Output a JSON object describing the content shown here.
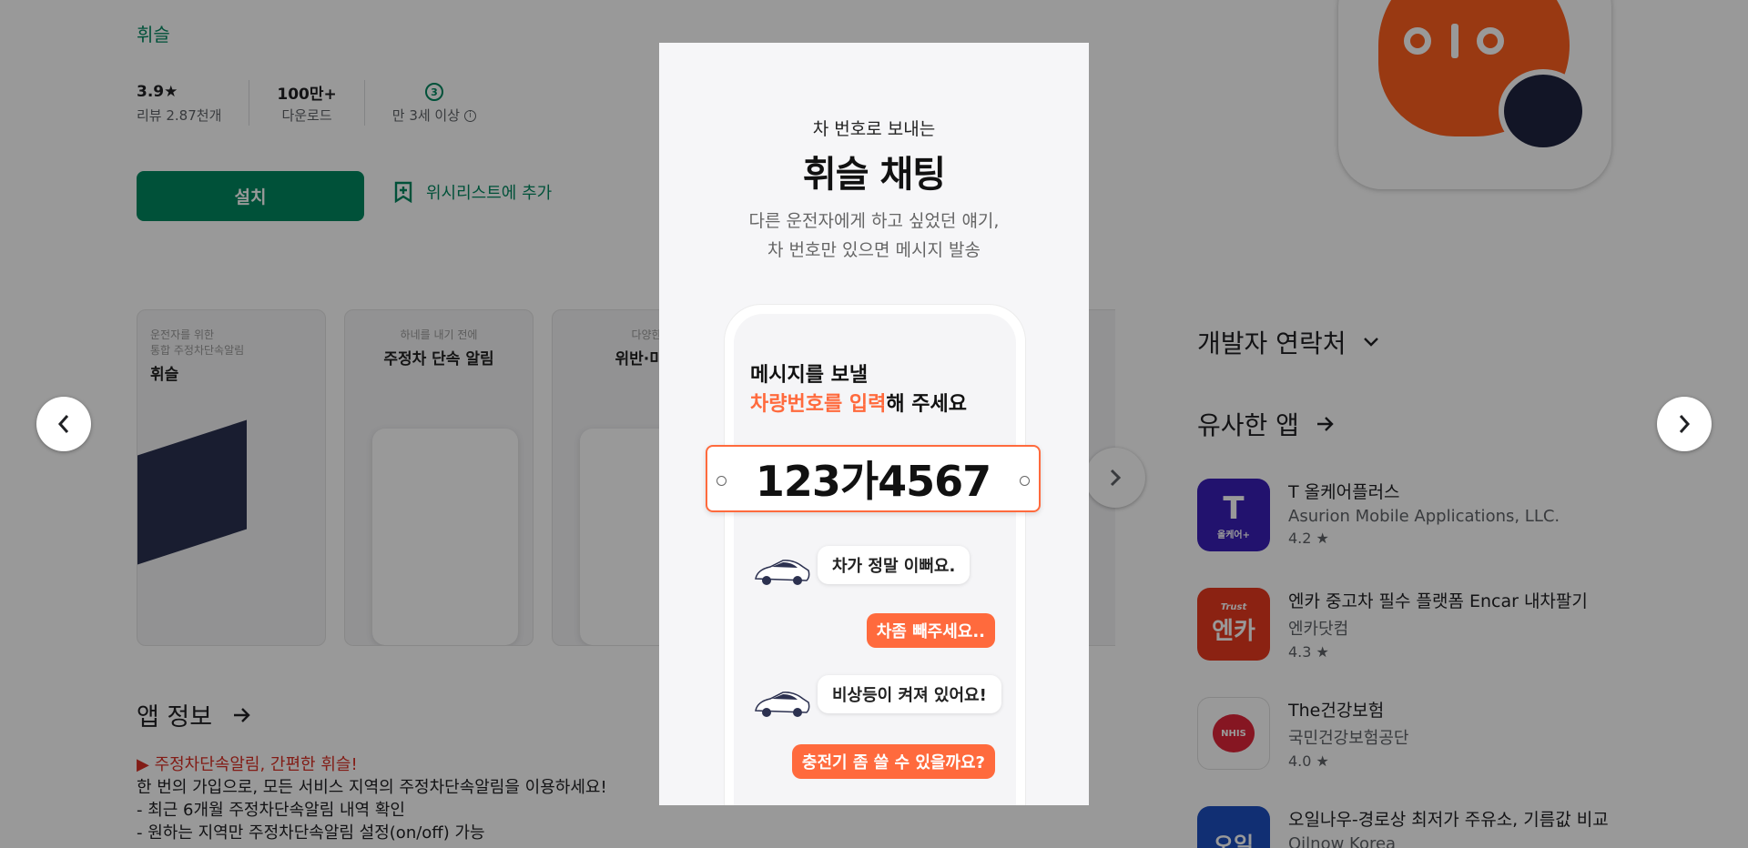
{
  "header": {
    "developer": "휘슬"
  },
  "stats": [
    {
      "value": "3.9★",
      "label": "리뷰 2.87천개"
    },
    {
      "value": "100만+",
      "label": "다운로드"
    },
    {
      "value": "3",
      "label": "만 3세 이상"
    }
  ],
  "actions": {
    "install": "설치",
    "wishlist": "위시리스트에 추가"
  },
  "screenshots": [
    {
      "small": "운전자를 위한\n통합 주정차단속알림",
      "big": "휘슬"
    },
    {
      "small": "하네를 내기 전에",
      "big": "주정차 단속 알림"
    },
    {
      "small": "다양한",
      "big": "위반·미납"
    }
  ],
  "about": {
    "title": "앱 정보",
    "lines": [
      "▶ 주정차단속알림, 간편한 휘슬!",
      "한 번의 가입으로, 모든 서비스 지역의 주정차단속알림을 이용하세요!",
      "- 최근 6개월 주정차단속알림 내역 확인",
      "- 원하는 지역만 주정차단속알림 설정(on/off) 가능"
    ]
  },
  "sidebar": {
    "developer_contact": "개발자 연락처",
    "similar_apps": "유사한 앱",
    "apps": [
      {
        "name": "T 올케어플러스",
        "developer": "Asurion Mobile Applications, LLC.",
        "rating": "4.2",
        "icon_text": "T",
        "icon_sub": "올케어+",
        "color": "#3a1fb8"
      },
      {
        "name": "엔카 중고차 필수 플랫폼 Encar 내차팔기",
        "developer": "엔카닷컴",
        "rating": "4.3",
        "icon_text": "엔카",
        "icon_sub": "Trust",
        "color": "#e8391e"
      },
      {
        "name": "The건강보험",
        "developer": "국민건강보험공단",
        "rating": "4.0",
        "icon_text": "NHIS",
        "icon_sub": "",
        "color": "#ffffff"
      },
      {
        "name": "오일나우-경로상 최저가 주유소, 기름값 비교",
        "developer": "Oilnow Korea",
        "rating": "",
        "icon_text": "오일",
        "icon_sub": "",
        "color": "#1d4fc0"
      }
    ]
  },
  "modal": {
    "subtitle": "차 번호로 보내는",
    "title": "휘슬 채팅",
    "desc_line1": "다른 운전자에게 하고 싶었던 얘기,",
    "desc_line2": "차 번호만 있으면 메시지 발송",
    "prompt_line1": "메시지를 보낼",
    "prompt_highlight": "차량번호를 입력",
    "prompt_rest": "해 주세요",
    "plate": "123가4567",
    "messages": [
      {
        "text": "차가 정말 이뻐요.",
        "side": "left"
      },
      {
        "text": "차좀 빼주세요..",
        "side": "right"
      },
      {
        "text": "비상등이 켜져 있어요!",
        "side": "left"
      },
      {
        "text": "충전기 좀 쓸 수 있을까요?",
        "side": "right"
      }
    ]
  },
  "colors": {
    "accent": "#01875f",
    "highlight": "#ff6a3d",
    "overlay": "rgba(0,0,0,0.4)"
  }
}
